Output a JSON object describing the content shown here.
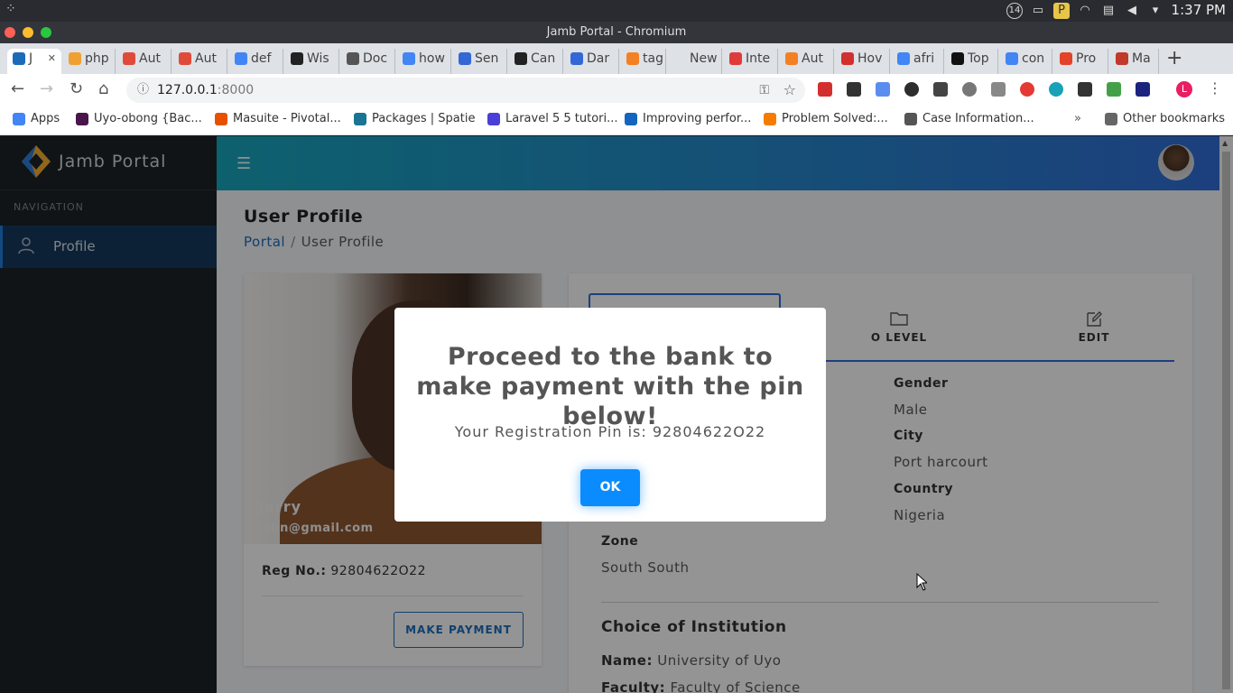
{
  "os": {
    "clock": "1:37 PM",
    "badge": "14"
  },
  "window": {
    "title": "Jamb Portal - Chromium"
  },
  "browser": {
    "tabs": [
      {
        "label": "J",
        "color": "#1c6bb8"
      },
      {
        "label": "php",
        "color": "#f0a030"
      },
      {
        "label": "Aut",
        "color": "#e04a3a"
      },
      {
        "label": "Aut",
        "color": "#e04a3a"
      },
      {
        "label": "def",
        "color": "#4285f4"
      },
      {
        "label": "Wis",
        "color": "#222222"
      },
      {
        "label": "Doc",
        "color": "#555555"
      },
      {
        "label": "how",
        "color": "#4285f4"
      },
      {
        "label": "Sen",
        "color": "#3367d6"
      },
      {
        "label": "Can",
        "color": "#222222"
      },
      {
        "label": "Dar",
        "color": "#3367d6"
      },
      {
        "label": "tag",
        "color": "#f48024"
      },
      {
        "label": "New Ta",
        "color": "#dee1e6"
      },
      {
        "label": "Inte",
        "color": "#e03a3a"
      },
      {
        "label": "Aut",
        "color": "#f48024"
      },
      {
        "label": "Hov",
        "color": "#d32f2f"
      },
      {
        "label": "afri",
        "color": "#4285f4"
      },
      {
        "label": "Top",
        "color": "#111111"
      },
      {
        "label": "con",
        "color": "#4285f4"
      },
      {
        "label": "Pro",
        "color": "#e24329"
      },
      {
        "label": "Ma",
        "color": "#c0392b"
      }
    ],
    "url_host": "127.0.0.1",
    "url_port": ":8000",
    "bookmarks": [
      {
        "label": "Apps",
        "color": "#4285f4"
      },
      {
        "label": "Uyo-obong {Bac...",
        "color": "#4a154b"
      },
      {
        "label": "Masuite - Pivotal...",
        "color": "#e65100"
      },
      {
        "label": "Packages | Spatie",
        "color": "#197593"
      },
      {
        "label": "Laravel 5 5 tutori...",
        "color": "#4a3fd6"
      },
      {
        "label": "Improving perfor...",
        "color": "#1565c0"
      },
      {
        "label": "Problem Solved:...",
        "color": "#f57c00"
      },
      {
        "label": "Case Information...",
        "color": "#555555"
      }
    ],
    "other_bookmarks": "Other bookmarks",
    "profile_initial": "L"
  },
  "sidebar": {
    "brand": "Jamb Portal",
    "nav_label": "NAVIGATION",
    "items": [
      {
        "label": "Profile"
      }
    ]
  },
  "page": {
    "title": "User Profile",
    "breadcrumb": {
      "home": "Portal",
      "separator": "/",
      "current": "User Profile"
    }
  },
  "profile_card": {
    "name": "Jerry",
    "email": "john@gmail.com",
    "reg_label": "Reg No.:",
    "reg_value": "92804622O22",
    "pay_button": "MAKE PAYMENT"
  },
  "info_card": {
    "tabs": [
      {
        "label": "O LEVEL"
      },
      {
        "label": "EDIT"
      }
    ],
    "fields": [
      {
        "label": "Gender",
        "value": "Male"
      },
      {
        "label": "City",
        "value": "Port harcourt"
      },
      {
        "label": "Country",
        "value": "Nigeria"
      },
      {
        "label": "Zone",
        "value": "South South"
      }
    ],
    "choice_title": "Choice of Institution",
    "choice": [
      {
        "label": "Name:",
        "value": "University of Uyo"
      },
      {
        "label": "Faculty:",
        "value": "Faculty of Science"
      }
    ]
  },
  "modal": {
    "title": "Proceed to the bank to make payment with the pin below!",
    "text": "Your Registration Pin is: 92804622O22",
    "ok": "OK"
  }
}
